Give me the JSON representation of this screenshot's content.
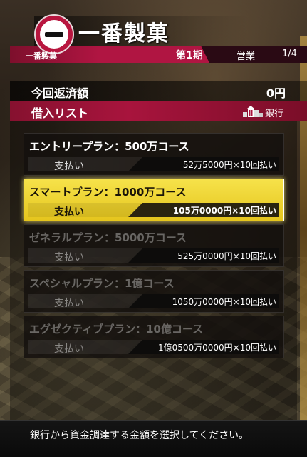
{
  "header": {
    "company_name": "一番製菓",
    "emblem_label": "一番製菓",
    "period": "第1期",
    "business": "営業",
    "counter": "1/4"
  },
  "repayment": {
    "label": "今回返済額",
    "value": "0円"
  },
  "loan_list": {
    "title": "借入リスト",
    "bank_label": "銀行",
    "bank_icon": "bank-building-icon"
  },
  "plans": [
    {
      "name": "エントリープラン：500万コース",
      "pay_label": "支払い",
      "amount": "52万5000円×10回払い",
      "state": "normal"
    },
    {
      "name": "スマートプラン：1000万コース",
      "pay_label": "支払い",
      "amount": "105万0000円×10回払い",
      "state": "selected"
    },
    {
      "name": "ゼネラルプラン：5000万コース",
      "pay_label": "支払い",
      "amount": "525万0000円×10回払い",
      "state": "disabled"
    },
    {
      "name": "スペシャルプラン：1億コース",
      "pay_label": "支払い",
      "amount": "1050万0000円×10回払い",
      "state": "disabled"
    },
    {
      "name": "エグゼクティブプラン：10億コース",
      "pay_label": "支払い",
      "amount": "1億0500万0000円×10回払い",
      "state": "disabled"
    }
  ],
  "footer": {
    "message": "銀行から資金調達する金額を選択してください。"
  },
  "colors": {
    "accent_red": "#b01542",
    "selected_yellow": "#f6e24a"
  }
}
